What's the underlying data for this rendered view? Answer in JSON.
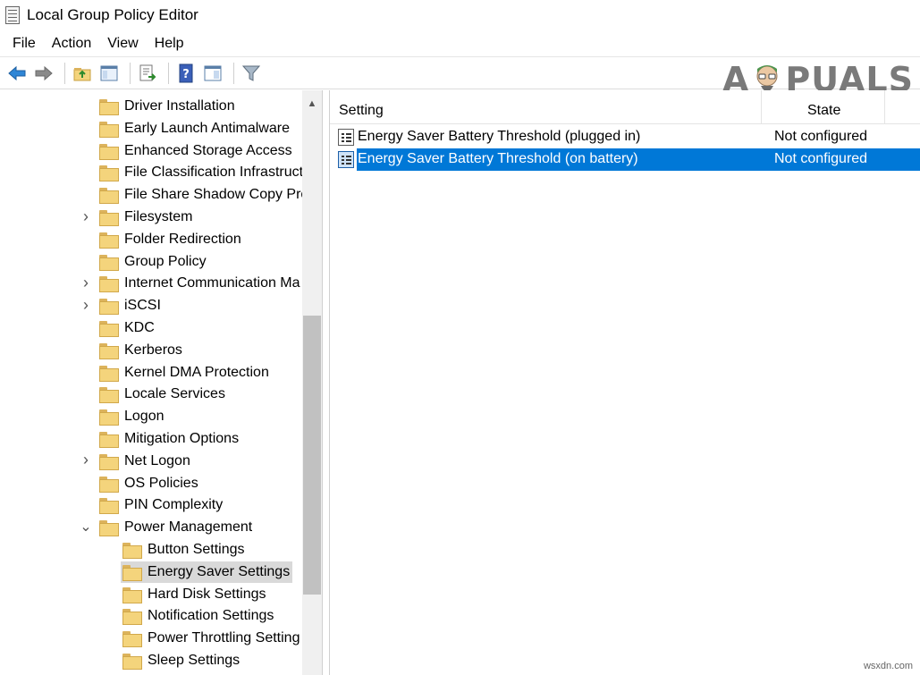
{
  "window": {
    "title": "Local Group Policy Editor"
  },
  "menu": [
    "File",
    "Action",
    "View",
    "Help"
  ],
  "toolbar": {
    "buttons": [
      "back-icon",
      "forward-icon",
      "up-folder-icon",
      "show-hide-console-tree-icon",
      "export-list-icon",
      "help-icon",
      "properties-icon",
      "filter-icon"
    ]
  },
  "watermark": {
    "left": "A",
    "right": "PUALS"
  },
  "tree": {
    "items": [
      {
        "label": "Driver Installation",
        "indent": 0,
        "chevron": ""
      },
      {
        "label": "Early Launch Antimalware",
        "indent": 0,
        "chevron": ""
      },
      {
        "label": "Enhanced Storage Access",
        "indent": 0,
        "chevron": ""
      },
      {
        "label": "File Classification Infrastruct",
        "indent": 0,
        "chevron": ""
      },
      {
        "label": "File Share Shadow Copy Pro",
        "indent": 0,
        "chevron": ""
      },
      {
        "label": "Filesystem",
        "indent": 0,
        "chevron": "collapsed"
      },
      {
        "label": "Folder Redirection",
        "indent": 0,
        "chevron": ""
      },
      {
        "label": "Group Policy",
        "indent": 0,
        "chevron": ""
      },
      {
        "label": "Internet Communication Ma",
        "indent": 0,
        "chevron": "collapsed"
      },
      {
        "label": "iSCSI",
        "indent": 0,
        "chevron": "collapsed"
      },
      {
        "label": "KDC",
        "indent": 0,
        "chevron": ""
      },
      {
        "label": "Kerberos",
        "indent": 0,
        "chevron": ""
      },
      {
        "label": "Kernel DMA Protection",
        "indent": 0,
        "chevron": ""
      },
      {
        "label": "Locale Services",
        "indent": 0,
        "chevron": ""
      },
      {
        "label": "Logon",
        "indent": 0,
        "chevron": ""
      },
      {
        "label": "Mitigation Options",
        "indent": 0,
        "chevron": ""
      },
      {
        "label": "Net Logon",
        "indent": 0,
        "chevron": "collapsed"
      },
      {
        "label": "OS Policies",
        "indent": 0,
        "chevron": ""
      },
      {
        "label": "PIN Complexity",
        "indent": 0,
        "chevron": ""
      },
      {
        "label": "Power Management",
        "indent": 0,
        "chevron": "expanded"
      },
      {
        "label": "Button Settings",
        "indent": 1,
        "chevron": ""
      },
      {
        "label": "Energy Saver Settings",
        "indent": 1,
        "chevron": "",
        "selected": true
      },
      {
        "label": "Hard Disk Settings",
        "indent": 1,
        "chevron": ""
      },
      {
        "label": "Notification Settings",
        "indent": 1,
        "chevron": ""
      },
      {
        "label": "Power Throttling Setting",
        "indent": 1,
        "chevron": ""
      },
      {
        "label": "Sleep Settings",
        "indent": 1,
        "chevron": ""
      }
    ]
  },
  "list": {
    "columns": {
      "setting": "Setting",
      "state": "State"
    },
    "rows": [
      {
        "name": "Energy Saver Battery Threshold (plugged in)",
        "state": "Not configured",
        "selected": false
      },
      {
        "name": "Energy Saver Battery Threshold (on battery)",
        "state": "Not configured",
        "selected": true
      }
    ]
  },
  "footer": {
    "mark": "wsxdn.com"
  }
}
